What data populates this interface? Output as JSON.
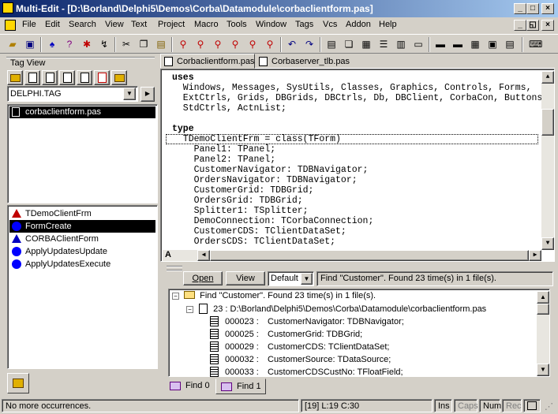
{
  "window": {
    "title": "Multi-Edit - [D:\\Borland\\Delphi5\\Demos\\Corba\\Datamodule\\corbaclientform.pas]"
  },
  "menu": [
    "File",
    "Edit",
    "Search",
    "View",
    "Text",
    "Project",
    "Macro",
    "Tools",
    "Window",
    "Tags",
    "Vcs",
    "Addon",
    "Help"
  ],
  "tagview": {
    "title": "Tag View",
    "tagfile": "DELPHI.TAG",
    "files": [
      "corbaclientform.pas"
    ],
    "symbols": [
      "TDemoClientFrm",
      "FormCreate",
      "CORBAClientForm",
      "ApplyUpdatesUpdate",
      "ApplyUpdatesExecute"
    ]
  },
  "editor": {
    "tabs": [
      "Corbaclientform.pas",
      "Corbaserver_tlb.pas"
    ],
    "lines": [
      {
        "t": "uses",
        "b": true
      },
      {
        "t": "  Windows, Messages, SysUtils, Classes, Graphics, Controls, Forms,"
      },
      {
        "t": "  ExtCtrls, Grids, DBGrids, DBCtrls, Db, DBClient, CorbaCon, Buttons,"
      },
      {
        "t": "  StdCtrls, ActnList;"
      },
      {
        "t": ""
      },
      {
        "t": "type",
        "b": true
      },
      {
        "t": "  TDemoClientFrm = class(TForm)"
      },
      {
        "t": "    Panel1: TPanel;"
      },
      {
        "t": "    Panel2: TPanel;"
      },
      {
        "t": "    CustomerNavigator: TDBNavigator;"
      },
      {
        "t": "    OrdersNavigator: TDBNavigator;"
      },
      {
        "t": "    CustomerGrid: TDBGrid;"
      },
      {
        "t": "    OrdersGrid: TDBGrid;"
      },
      {
        "t": "    Splitter1: TSplitter;"
      },
      {
        "t": "    DemoConnection: TCorbaConnection;"
      },
      {
        "t": "    CustomerCDS: TClientDataSet;"
      },
      {
        "t": "    OrdersCDS: TClientDataSet;"
      }
    ],
    "corner_label": "A"
  },
  "results": {
    "open": "Open",
    "view": "View",
    "filter": "Default",
    "summary": "Find \"Customer\".  Found 23 time(s) in 1 file(s).",
    "root": "Find \"Customer\".  Found 23 time(s) in 1 file(s).",
    "file": "23 : D:\\Borland\\Delphi5\\Demos\\Corba\\Datamodule\\corbaclientform.pas",
    "hits": [
      {
        "line": "000023 :",
        "text": "CustomerNavigator: TDBNavigator;"
      },
      {
        "line": "000025 :",
        "text": "CustomerGrid: TDBGrid;"
      },
      {
        "line": "000029 :",
        "text": "CustomerCDS: TClientDataSet;"
      },
      {
        "line": "000032 :",
        "text": "CustomerSource: TDataSource;"
      },
      {
        "line": "000033 :",
        "text": "CustomerCDSCustNo: TFloatField;"
      }
    ],
    "tabs": [
      "Find 0",
      "Find 1"
    ]
  },
  "status": {
    "message": "No more occurrences.",
    "position": "[19] L:19 C:30",
    "ins": "Ins",
    "caps": "Caps",
    "num": "Num",
    "rec": "Rec"
  }
}
